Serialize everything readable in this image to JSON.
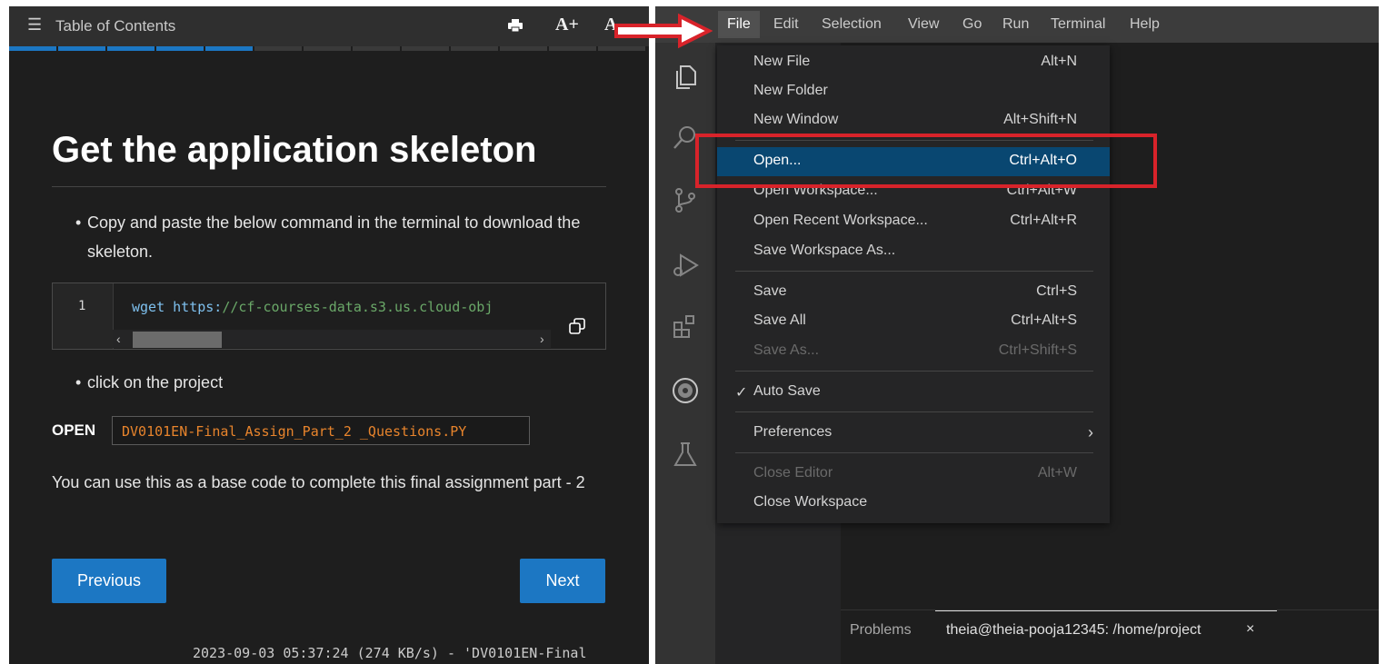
{
  "left_panel": {
    "toc_title": "Table of Contents",
    "font_increase": "A+",
    "font_decrease": "A",
    "progress_segments_completed": 5,
    "progress_segments_total": 13,
    "heading": "Get the application skeleton",
    "bullet1": "Copy and paste the below command in the terminal to download the skeleton.",
    "code": {
      "line_number": "1",
      "keyword": "wget",
      "url_prefix": "https:",
      "url_rest": "//cf-courses-data.s3.us.cloud-obj"
    },
    "bullet2": "click on the project",
    "open_label": "OPEN",
    "open_file": "DV0101EN-Final_Assign_Part_2 _Questions.PY",
    "paragraph": "You can use this as a base code to complete this final assignment part - 2",
    "prev_button": "Previous",
    "next_button": "Next"
  },
  "ide": {
    "menubar": [
      "File",
      "Edit",
      "Selection",
      "View",
      "Go",
      "Run",
      "Terminal",
      "Help"
    ],
    "file_menu": {
      "items": [
        {
          "label": "New File",
          "shortcut": "Alt+N"
        },
        {
          "label": "New Folder",
          "shortcut": ""
        },
        {
          "label": "New Window",
          "shortcut": "Alt+Shift+N"
        },
        {
          "label": "Open...",
          "shortcut": "Ctrl+Alt+O"
        },
        {
          "label": "Open Workspace...",
          "shortcut": "Ctrl+Alt+W"
        },
        {
          "label": "Open Recent Workspace...",
          "shortcut": "Ctrl+Alt+R"
        },
        {
          "label": "Save Workspace As...",
          "shortcut": ""
        },
        {
          "label": "Save",
          "shortcut": "Ctrl+S"
        },
        {
          "label": "Save All",
          "shortcut": "Ctrl+Alt+S"
        },
        {
          "label": "Save As...",
          "shortcut": "Ctrl+Shift+S"
        },
        {
          "label": "Auto Save",
          "shortcut": ""
        },
        {
          "label": "Preferences",
          "shortcut": ""
        },
        {
          "label": "Close Editor",
          "shortcut": "Alt+W"
        },
        {
          "label": "Close Workspace",
          "shortcut": ""
        }
      ]
    },
    "panel": {
      "problems_tab": "Problems",
      "terminal_tab": "theia@theia-pooja12345: /home/project",
      "close_glyph": "×",
      "terminal_text": "2023-09-03 05:37:24 (274 KB/s) - 'DV0101EN-Final"
    }
  },
  "colors": {
    "accent_blue": "#1c77c3",
    "annotation_red": "#d8232a",
    "menu_highlight": "#094771",
    "code_filename_orange": "#e8842c"
  }
}
